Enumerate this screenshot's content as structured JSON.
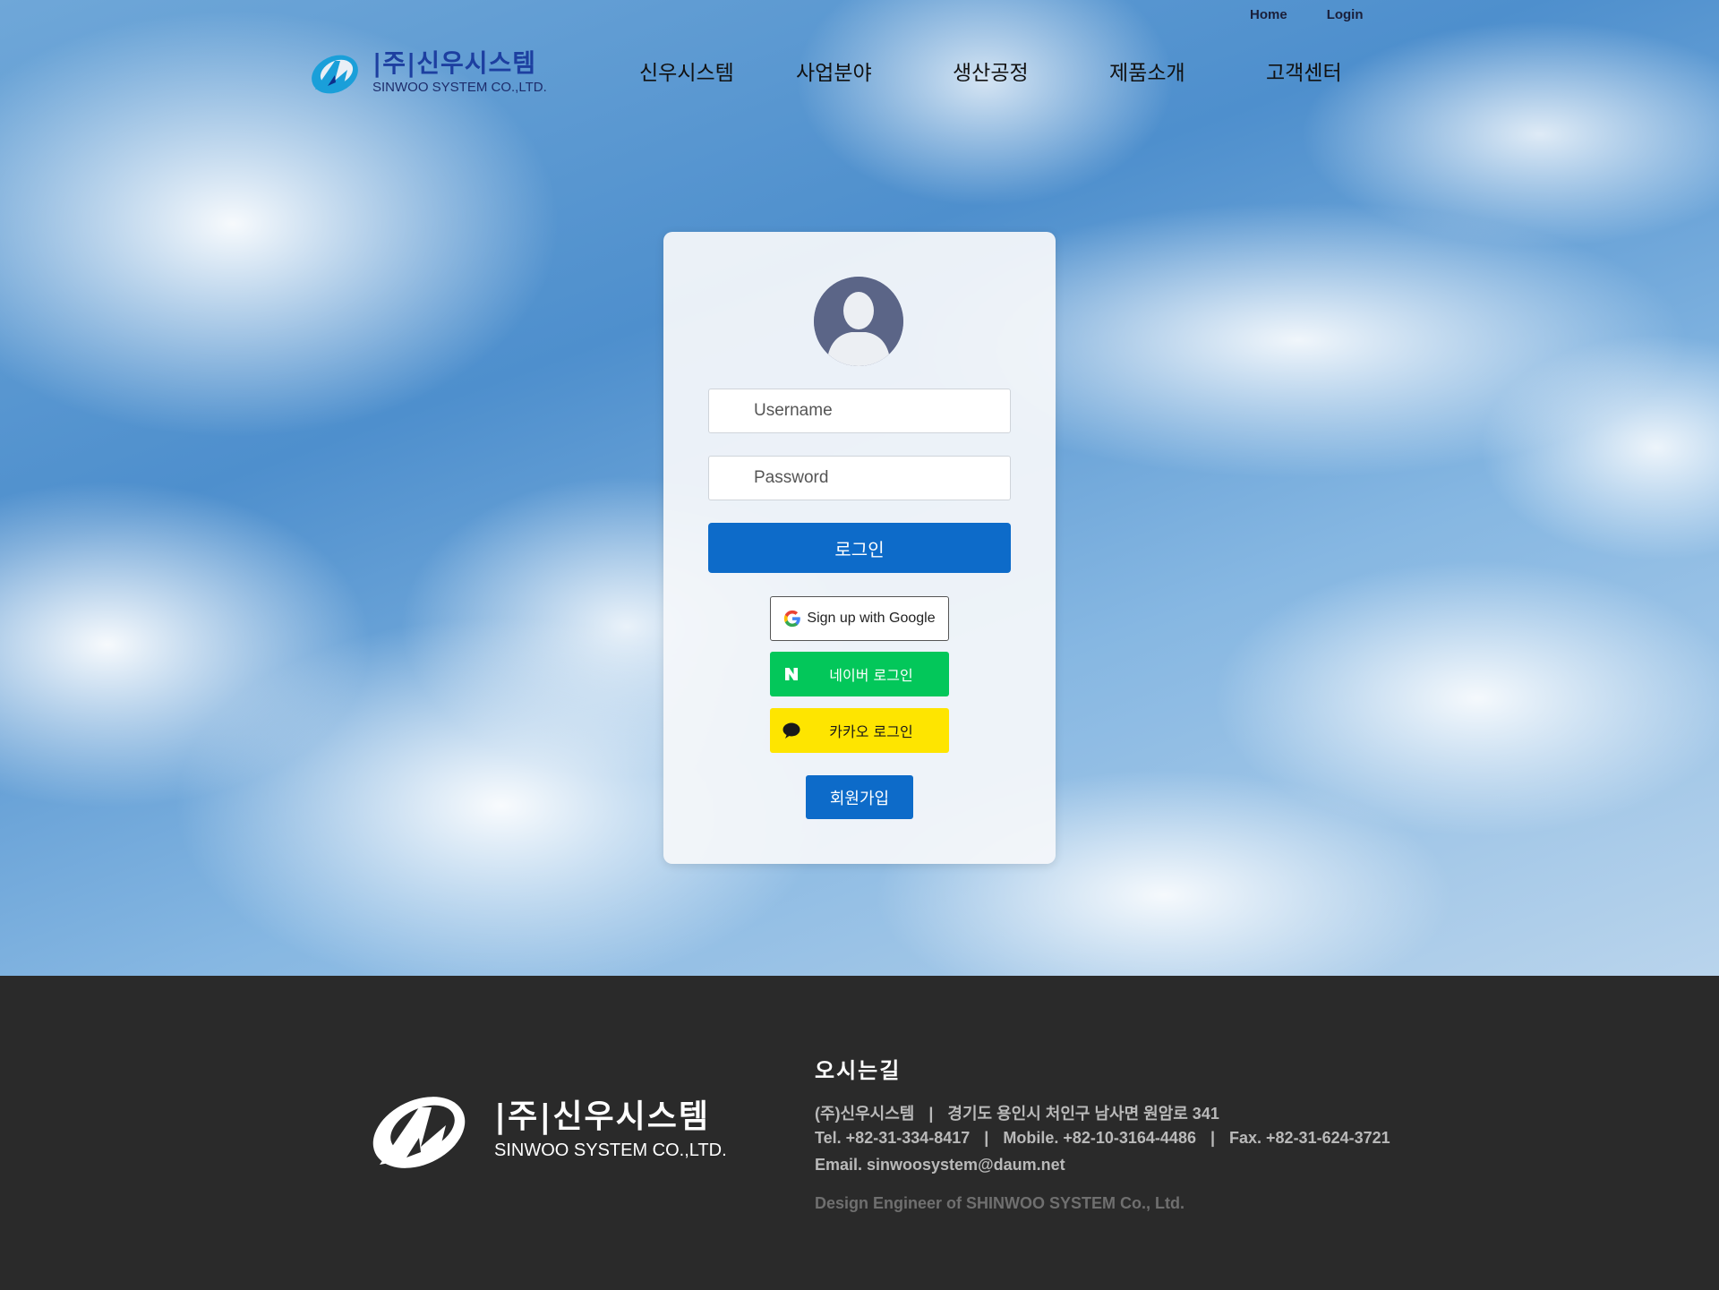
{
  "header": {
    "top_links": [
      "Home",
      "Login"
    ],
    "logo": {
      "korean": "|주|신우시스템",
      "english": "SINWOO SYSTEM CO.,LTD."
    },
    "nav": [
      "신우시스템",
      "사업분야",
      "생산공정",
      "제품소개",
      "고객센터"
    ]
  },
  "login": {
    "username_placeholder": "Username",
    "password_placeholder": "Password",
    "login_button": "로그인",
    "google_button": "Sign up with Google",
    "naver_button": "네이버 로그인",
    "kakao_button": "카카오 로그인",
    "signup_button": "회원가입"
  },
  "footer": {
    "logo": {
      "korean": "|주|신우시스템",
      "english": "SINWOO SYSTEM CO.,LTD."
    },
    "title": "오시는길",
    "company": "(주)신우시스템",
    "address": "경기도 용인시 처인구 남사면 원암로 341",
    "tel": "Tel. +82-31-334-8417",
    "mobile": "Mobile. +82-10-3164-4486",
    "fax": "Fax. +82-31-624-3721",
    "email": "Email. sinwoosystem@daum.net",
    "design_credit": "Design Engineer of SHINWOO SYSTEM Co., Ltd.",
    "separator": "|"
  },
  "colors": {
    "primary_blue": "#0d6bc9",
    "naver_green": "#03c75a",
    "kakao_yellow": "#fee500",
    "footer_bg": "#2a2a2a",
    "logo_blue": "#1d3fa0"
  },
  "icons": [
    "avatar-icon",
    "google-icon",
    "naver-icon",
    "kakao-icon",
    "logo-icon"
  ]
}
